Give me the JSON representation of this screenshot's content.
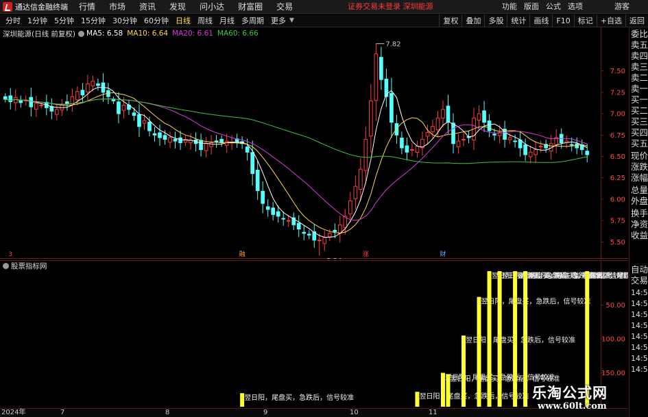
{
  "app": {
    "title": "通达信金融终端"
  },
  "menu": {
    "items": [
      "行情",
      "市场",
      "资讯",
      "发现",
      "问小达",
      "财富圈",
      "交易"
    ],
    "notice": "证券交易未登录  深圳能源",
    "right": [
      "功能",
      "版面",
      "公式",
      "选项"
    ],
    "guest": "游客"
  },
  "periods": [
    "分时",
    "1分钟",
    "5分钟",
    "15分钟",
    "30分钟",
    "60分钟",
    "日线",
    "周线",
    "月线",
    "多周期",
    "更多"
  ],
  "active_period": "日线",
  "toolbar_right": [
    "复权",
    "叠加",
    "多股",
    "统计",
    "画线",
    "F10",
    "标记",
    "+自选",
    "返回"
  ],
  "stock_header": {
    "name": "深圳能源(日线 前复权)",
    "ma5": "MA5: 6.58",
    "ma10": "MA10: 6.64",
    "ma20": "MA20: 6.61",
    "ma60": "MA60: 6.66"
  },
  "colors": {
    "up": "#ff3c3c",
    "down": "#54ffff",
    "ma5": "#ffffff",
    "ma10": "#ffd84a",
    "ma20": "#d93ad9",
    "ma60": "#3ec43e",
    "grid": "#6a1a1a",
    "axis_text": "#ff4a4a",
    "signal": "#ffff33"
  },
  "main_markers": {
    "high": "7.82",
    "low": "5.34",
    "events": [
      "3",
      "融",
      "涨",
      "财"
    ]
  },
  "indicator": {
    "title": "股票指标网",
    "signal_text": "翌日阳，尾盘买，急跌后，信号较准",
    "axis_ticks": [
      "150.00",
      "100.00",
      "50.00"
    ]
  },
  "date_axis": [
    "2024年",
    "7",
    "8",
    "9",
    "10",
    "11"
  ],
  "sidebar": {
    "top": [
      "委比",
      "卖五",
      "卖四",
      "卖三",
      "卖二",
      "卖一",
      "买一",
      "买二",
      "买三",
      "买四",
      "买五",
      "现价",
      "涨跌",
      "涨幅",
      "总量",
      "外盘",
      "换手",
      "净资",
      "收益"
    ],
    "bottom": [
      "自动",
      "交易",
      "14:50",
      "14:50",
      "14:50",
      "14:50",
      "14:50",
      "14:50",
      "14:50",
      "14:50"
    ]
  },
  "watermark": {
    "title": "乐淘公式网",
    "url": "www.60lt.com"
  },
  "chart_data": [
    {
      "type": "candlestick",
      "title": "深圳能源(日线 前复权)",
      "ylim": [
        5.35,
        7.85
      ],
      "y_ticks": [
        5.5,
        5.75,
        6.0,
        6.25,
        6.5,
        6.75,
        7.0,
        7.25,
        7.5
      ],
      "y_tick_labels": [
        "5.50",
        "5.75",
        "6.00",
        "6.25",
        "6.50",
        "6.75",
        "7.00",
        "7.25",
        "7.50"
      ],
      "x_labels": [
        "2024年",
        "7",
        "8",
        "9",
        "10",
        "11"
      ],
      "close": [
        7.17,
        7.14,
        7.19,
        7.13,
        7.16,
        7.08,
        7.12,
        7.1,
        7.07,
        7.03,
        7.05,
        7.1,
        7.12,
        7.2,
        7.26,
        7.22,
        7.35,
        7.38,
        7.33,
        7.25,
        7.2,
        7.15,
        7.0,
        7.1,
        7.05,
        6.98,
        6.85,
        6.92,
        6.8,
        6.75,
        6.72,
        6.7,
        6.72,
        6.68,
        6.66,
        6.7,
        6.69,
        6.65,
        6.58,
        6.65,
        6.66,
        6.67,
        6.66,
        6.68,
        6.67,
        6.66,
        6.65,
        6.55,
        6.3,
        6.1,
        5.95,
        5.88,
        5.82,
        5.8,
        5.77,
        5.75,
        5.7,
        5.65,
        5.6,
        5.58,
        5.52,
        5.52,
        5.55,
        5.6,
        5.62,
        5.7,
        5.8,
        5.98,
        6.15,
        6.35,
        6.7,
        7.15,
        7.7,
        7.4,
        7.2,
        6.9,
        6.75,
        6.6,
        6.55,
        6.58,
        6.62,
        6.7,
        6.78,
        6.85,
        6.95,
        7.05,
        6.9,
        6.65,
        6.68,
        6.7,
        6.72,
        6.95,
        7.0,
        6.9,
        6.8,
        6.75,
        6.78,
        6.7,
        6.72,
        6.68,
        6.6,
        6.52,
        6.55,
        6.58,
        6.62,
        6.6,
        6.65,
        6.72,
        6.66,
        6.68,
        6.64,
        6.6,
        6.58,
        6.52
      ]
    },
    {
      "type": "bar",
      "title": "股票指标网",
      "series_name": "翌日阳，尾盘买，急跌后，信号较准",
      "ylim": [
        0,
        200
      ],
      "y_ticks": [
        50,
        100,
        150
      ],
      "bars": [
        {
          "index": 46,
          "value": 20
        },
        {
          "index": 80,
          "value": 22
        },
        {
          "index": 85,
          "value": 50
        },
        {
          "index": 86,
          "value": 48
        },
        {
          "index": 89,
          "value": 105
        },
        {
          "index": 92,
          "value": 162
        },
        {
          "index": 94,
          "value": 200
        },
        {
          "index": 96,
          "value": 200
        },
        {
          "index": 99,
          "value": 200
        },
        {
          "index": 101,
          "value": 200
        },
        {
          "index": 113,
          "value": 200
        }
      ]
    }
  ]
}
